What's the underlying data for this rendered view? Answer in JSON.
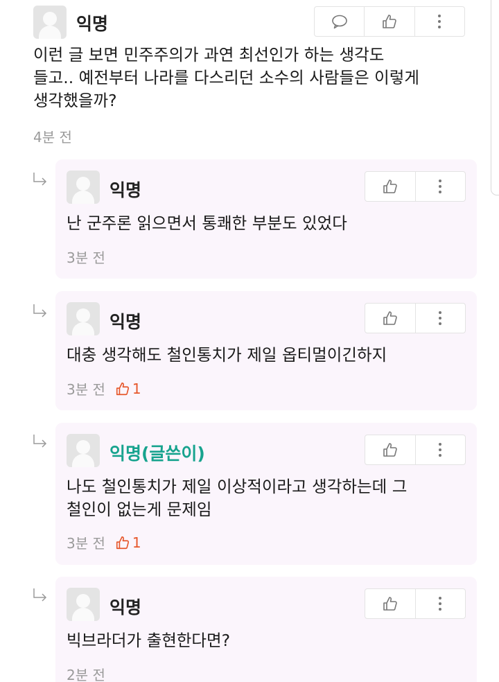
{
  "main_comment": {
    "author": "익명",
    "text_lines": [
      "이런 글 보면 민주주의가 과연 최선인가 하는 생각도",
      "들고.. 예전부터 나라를 다스리던 소수의 사람들은 이렇게",
      "생각했을까?"
    ],
    "time": "4분 전",
    "actions": [
      "comment-icon",
      "thumbs-up-icon",
      "more-icon"
    ]
  },
  "replies": [
    {
      "author": "익명",
      "text_lines": [
        "난 군주론 읽으면서 통쾌한 부분도 있었다"
      ],
      "time": "3분 전",
      "likes": ""
    },
    {
      "author": "익명",
      "text_lines": [
        "대충 생각해도 철인통치가 제일 옵티멀이긴하지"
      ],
      "time": "3분 전",
      "likes": "1"
    },
    {
      "author": "익명(글쓴이)",
      "text_lines": [
        "나도 철인통치가 제일 이상적이라고 생각하는데 그",
        "철인이 없는게 문제임"
      ],
      "time": "3분 전",
      "likes": "1"
    },
    {
      "author": "익명",
      "text_lines": [
        "빅브라더가 출현한다면?"
      ],
      "time": "2분 전",
      "likes": ""
    }
  ],
  "colors": {
    "op_author": "#17a38e",
    "like_accent": "#e6572b",
    "reply_background": "#fbf5fc"
  }
}
